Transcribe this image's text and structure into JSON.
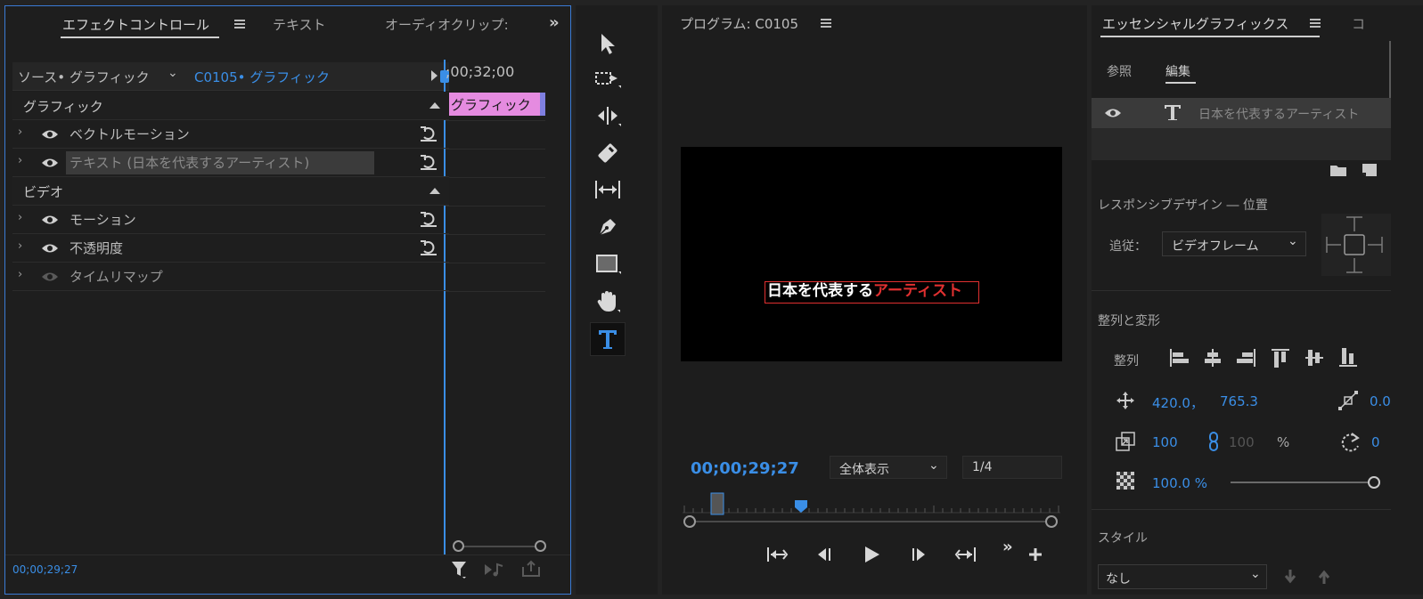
{
  "effect_controls": {
    "tabs": [
      "エフェクトコントロール",
      "テキスト",
      "オーディオクリップ:"
    ],
    "source_label": "ソース• グラフィック",
    "clip_label": "C0105• グラフィック",
    "timecode_ruler": ";00;32;00",
    "clip_bar_label": "グラフィック",
    "sections": {
      "graphic": "グラフィック",
      "video": "ビデオ"
    },
    "graphic_rows": [
      "ベクトルモーション",
      "テキスト (日本を代表するアーティスト)"
    ],
    "video_rows": [
      "モーション",
      "不透明度",
      "タイムリマップ"
    ],
    "footer_timecode": "00;00;29;27"
  },
  "program_monitor": {
    "title": "プログラム: C0105",
    "video_text": {
      "white_part": "日本を代表する",
      "red_part": "アーティスト"
    },
    "timecode": "00;00;29;27",
    "zoom": "全体表示",
    "resolution": "1/4"
  },
  "essential_graphics": {
    "title": "エッセンシャルグラフィックス",
    "second_tab_fragment": "コ",
    "tabs": [
      "参照",
      "編集"
    ],
    "layer_name": "日本を代表するアーティスト",
    "responsive_title": "レスポンシブデザイン ― 位置",
    "follow_label": "追従：",
    "follow_value": "ビデオフレーム",
    "align_title": "整列と変形",
    "align_label": "整列",
    "position_x": "420.0，",
    "position_y": "765.3",
    "anchor_value": "0.0",
    "scale": "100",
    "scale_linked": "100",
    "percent": "%",
    "rotation": "0",
    "opacity": "100.0 %",
    "style_title": "スタイル",
    "style_value": "なし"
  },
  "colors": {
    "accent_blue": "#3a8ee6",
    "clip_pink": "#e58be0",
    "text_red": "#e03030"
  }
}
